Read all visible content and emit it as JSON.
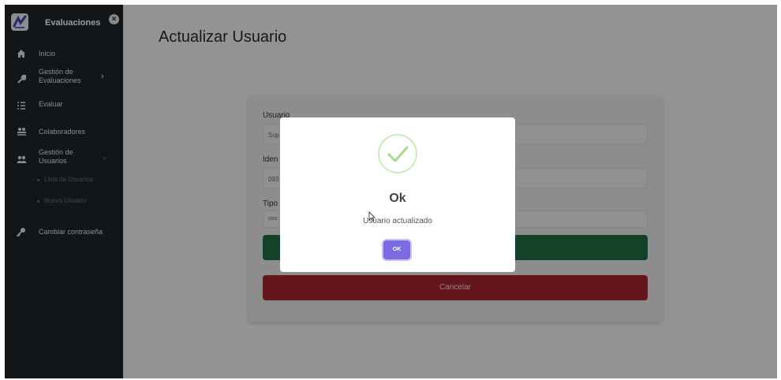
{
  "sidebar": {
    "brand_title": "Evaluaciones",
    "close_glyph": "×",
    "items": [
      {
        "label": "Inicio",
        "icon": "home-icon"
      },
      {
        "label": "Gestión de\nEvaluaciones",
        "icon": "wrench-icon"
      },
      {
        "label": "Evaluar",
        "icon": "list-icon"
      },
      {
        "label": "Colaboradores",
        "icon": "users-icon"
      },
      {
        "label": "Gestión de\nUsuarios",
        "icon": "user-group-icon"
      },
      {
        "label": "Cambiar contraseña",
        "icon": "key-icon"
      }
    ],
    "subitems": [
      {
        "label": "Lista de Usuarios"
      },
      {
        "label": "Nuevo Usuario"
      }
    ],
    "chevron_right": "›",
    "chevron_down": "⌄"
  },
  "main": {
    "title": "Actualizar Usuario",
    "fields": [
      {
        "label": "Usuario",
        "value": "Sup"
      },
      {
        "label": "Iden",
        "value": "093"
      },
      {
        "label": "Tipo",
        "value": "usu"
      }
    ],
    "cancel_label": "Cancelar"
  },
  "modal": {
    "title": "Ok",
    "message": "Usuario actualizado",
    "ok_label": "OK"
  },
  "colors": {
    "sidebar_bg": "#212529",
    "save_green": "#1e6f47",
    "cancel_red": "#a7252f",
    "ok_purple": "#7a6ce0",
    "success_green": "#a5dc86"
  }
}
